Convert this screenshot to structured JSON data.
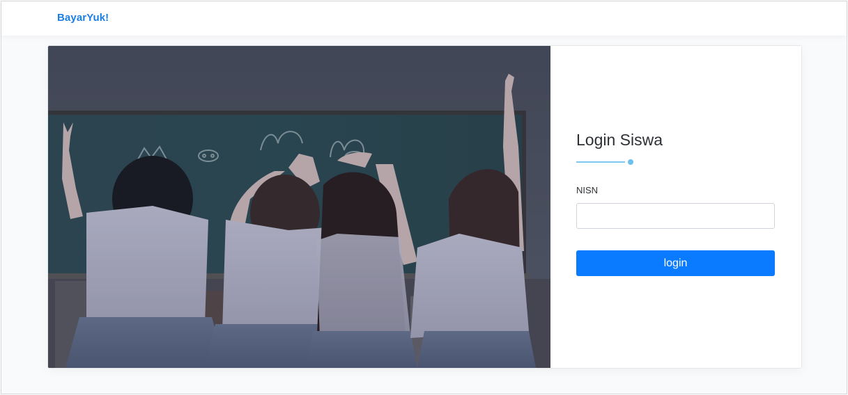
{
  "navbar": {
    "brand": "BayarYuk!"
  },
  "hero_image": {
    "icon": "students-classroom-photo"
  },
  "login_form": {
    "title": "Login Siswa",
    "nisn_label": "NISN",
    "nisn_value": "",
    "nisn_placeholder": "",
    "submit_label": "login"
  },
  "colors": {
    "brand": "#1a7fe5",
    "accent_line": "#7fc7f0",
    "button": "#0a7bff"
  }
}
